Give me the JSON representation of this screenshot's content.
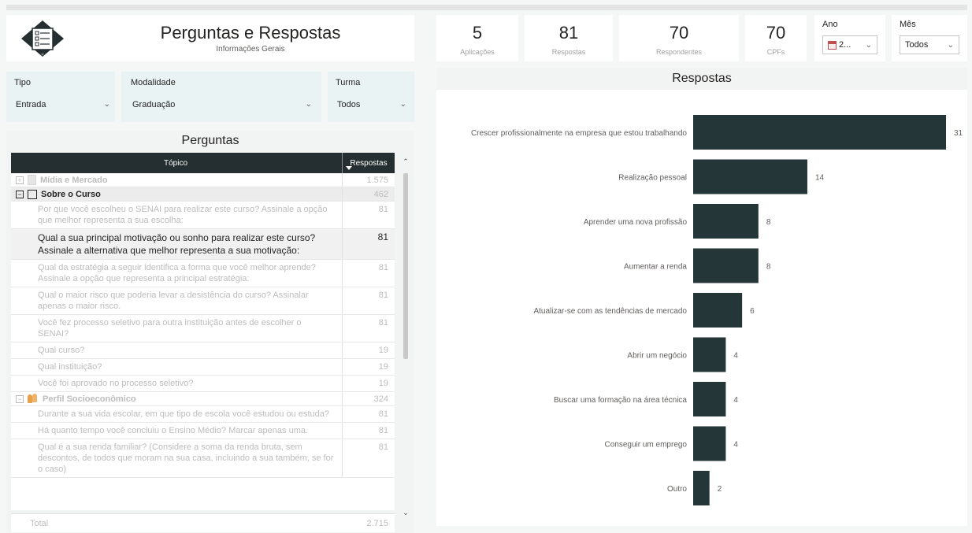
{
  "header": {
    "title": "Perguntas e Respostas",
    "subtitle": "Informações Gerais"
  },
  "kpis": [
    {
      "value": "5",
      "label": "Aplicações"
    },
    {
      "value": "81",
      "label": "Respostas"
    },
    {
      "value": "70",
      "label": "Respondentes"
    },
    {
      "value": "70",
      "label": "CPFs"
    }
  ],
  "slicers": {
    "ano": {
      "title": "Ano",
      "value": "2..."
    },
    "mes": {
      "title": "Mês",
      "value": "Todos"
    }
  },
  "filters": {
    "tipo": {
      "title": "Tipo",
      "value": "Entrada"
    },
    "modalidade": {
      "title": "Modalidade",
      "value": "Graduação"
    },
    "turma": {
      "title": "Turma",
      "value": "Todos"
    }
  },
  "perguntas": {
    "title": "Perguntas",
    "col_topic": "Tópico",
    "col_resp": "Respostas",
    "groups": [
      {
        "label": "Mídia e Mercado",
        "count": "1.575",
        "expanded": false
      },
      {
        "label": "Sobre o Curso",
        "count": "462",
        "expanded": true
      },
      {
        "label": "Perfil Socioeconômico",
        "count": "324",
        "expanded": true
      }
    ],
    "sobre_rows": [
      {
        "text": "Por que você escolheu o SENAI para realizar este curso? Assinale a opção que melhor representa a sua escolha:",
        "count": "81",
        "selected": false
      },
      {
        "text": "Qual a sua principal motivação ou sonho para realizar este curso? Assinale a alternativa que melhor representa a sua motivação:",
        "count": "81",
        "selected": true
      },
      {
        "text": "Qual da estratégia a seguir identifica a forma que você melhor aprende? Assinale a opção que representa a principal estratégia:",
        "count": "81",
        "selected": false
      },
      {
        "text": "Qual o maior risco que poderia levar a desistência do curso? Assinalar apenas o maior risco.",
        "count": "81",
        "selected": false
      },
      {
        "text": "Você fez processo seletivo para outra instituição antes de escolher o SENAI?",
        "count": "81",
        "selected": false
      },
      {
        "text": "Qual curso?",
        "count": "19",
        "selected": false
      },
      {
        "text": "Qual instituição?",
        "count": "19",
        "selected": false
      },
      {
        "text": "Você foi aprovado no processo seletivo?",
        "count": "19",
        "selected": false
      }
    ],
    "perfil_rows": [
      {
        "text": "Durante a sua vida escolar, em que tipo de escola você estudou ou estuda?",
        "count": "81"
      },
      {
        "text": "Há quanto tempo você concluiu o Ensino Médio? Marcar apenas uma.",
        "count": "81"
      },
      {
        "text": "Qual é a sua renda familiar? (Considere a soma da renda bruta, sem descontos, de todos que moram na sua casa, incluindo a sua também, se for o caso)",
        "count": "81"
      }
    ],
    "total_label": "Total",
    "total_count": "2.715"
  },
  "chart_data": {
    "type": "bar",
    "orientation": "horizontal",
    "title": "Respostas",
    "categories": [
      "Crescer profissionalmente na empresa que estou trabalhando",
      "Realização pessoal",
      "Aprender uma nova profissão",
      "Aumentar a renda",
      "Atualizar-se com as tendências de mercado",
      "Abrir um negócio",
      "Buscar uma formação na área técnica",
      "Conseguir um emprego",
      "Outro"
    ],
    "values": [
      31,
      14,
      8,
      8,
      6,
      4,
      4,
      4,
      2
    ],
    "xlim": [
      0,
      31
    ],
    "bar_color": "#253638",
    "grid": false,
    "legend": "none"
  },
  "colors": {
    "dark": "#252f31",
    "filter_bg": "#e9f3f4",
    "accent_orange": "#e8a04a"
  }
}
